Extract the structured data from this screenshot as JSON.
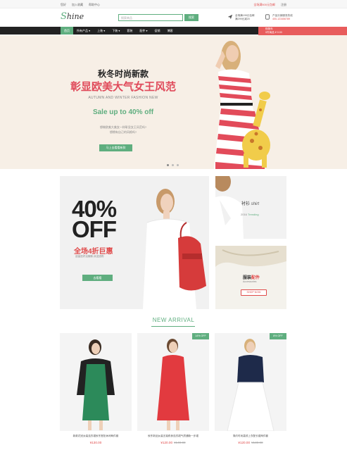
{
  "topbar": {
    "left": [
      "您好",
      "加入收藏",
      "帮助中心"
    ],
    "right": [
      "全场满500元包邮",
      "注册"
    ]
  },
  "header": {
    "logo_s": "S",
    "logo_rest": "hine",
    "search_placeholder": "搜索商品",
    "search_button": "搜索",
    "info1": [
      "全场满199元包邮",
      "满299元减20"
    ],
    "info2": [
      "产品分销服务热线",
      "400-123456789"
    ]
  },
  "nav": {
    "items": [
      "首页",
      "所有产品 ▾",
      "上装 ▾",
      "下装 ▾",
      "套装",
      "配件 ▾",
      "促销",
      "博客"
    ],
    "cart_line1": "购物车",
    "cart_line2": "0件商品 ¥ 0.00"
  },
  "hero": {
    "title1": "秋冬时尚新款",
    "title2": "彰显欧美大气女王风范",
    "subtitle": "AUTUMN AND WINTER FASHION NEW",
    "sale": "Sale up to 40% off",
    "desc1": "想做欧美大美女一样彰显女王风范吗?",
    "desc2": "想拥有自己的风格吗?",
    "cta": "马上去看看新款"
  },
  "promo_big": {
    "pct": "40%",
    "off": "OFF",
    "cn": "全场4折巨惠",
    "sub": "适量选好活服款,欢迎选购",
    "btn": "去看看"
  },
  "promo_a": {
    "cn": "衬衫",
    "en": "shirt",
    "year": "2016",
    "trend": "Trending"
  },
  "promo_b": {
    "cn1": "服装",
    "cn2": "配件",
    "en": "Accessories",
    "btn": "SHOP NOW"
  },
  "arrival": {
    "title": "NEW ARRIVAL"
  },
  "products": [
    {
      "title": "新款花冠女装连衣裙秋冬宽松休闲两件套",
      "price": "¥130.00",
      "old": "",
      "badge": ""
    },
    {
      "title": "秋冬新品女装无袖修身连衣裙气质通勤一步裙",
      "price": "¥120.00",
      "old": "¥140.00",
      "badge": "14% OFF"
    },
    {
      "title": "简约时尚高领上衣配长裙两件套",
      "price": "¥120.00",
      "old": "¥130.00",
      "badge": "8% OFF"
    }
  ],
  "colors": {
    "accent": "#5fae7f",
    "red": "#e04a4a",
    "nav": "#222222",
    "hero_bg": "#f7efe6"
  }
}
